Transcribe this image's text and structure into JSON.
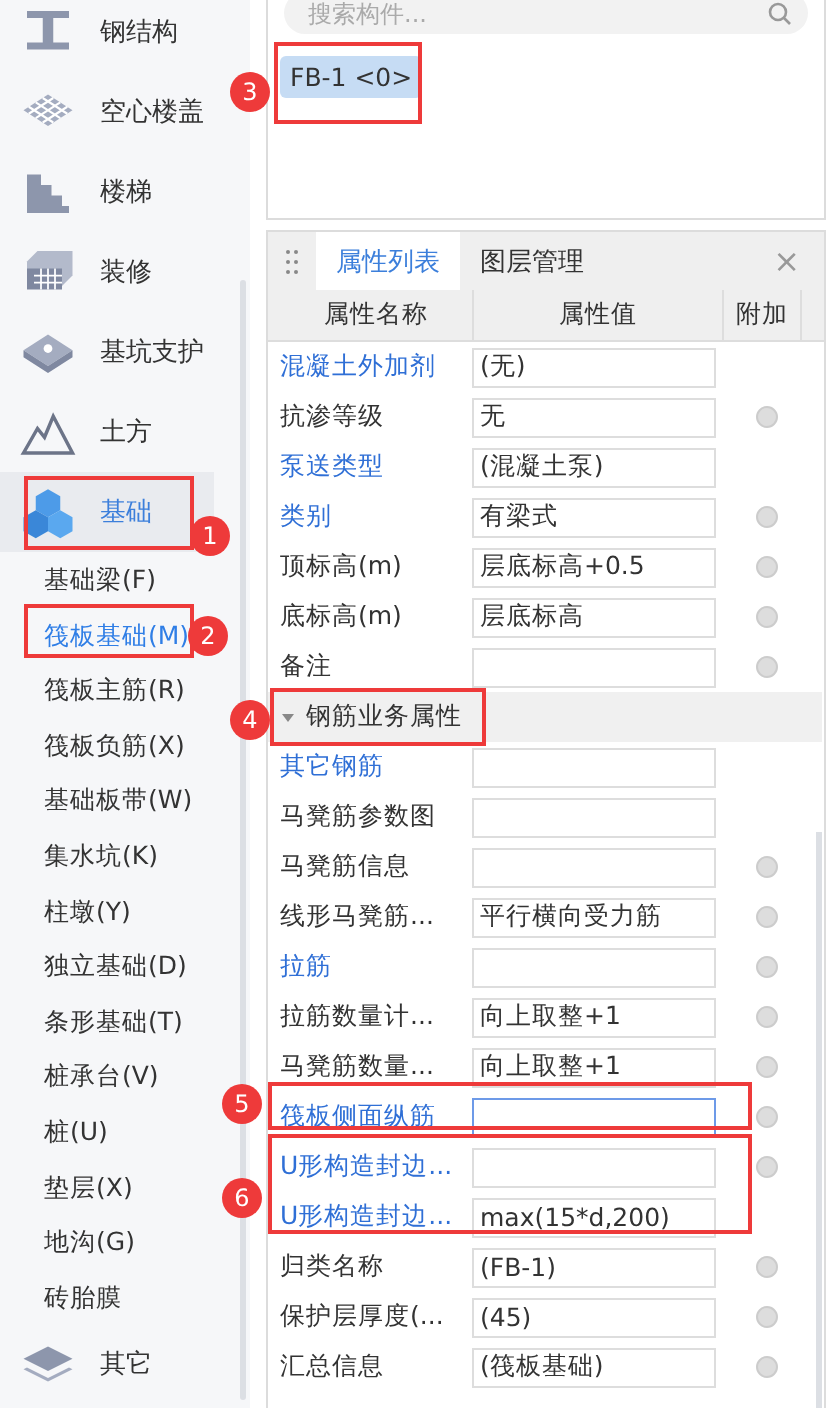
{
  "sidebar": {
    "categories": [
      {
        "label": "钢结构",
        "kind": "beam",
        "selected": false
      },
      {
        "label": "空心楼盖",
        "kind": "grid",
        "selected": false
      },
      {
        "label": "楼梯",
        "kind": "stairs",
        "selected": false
      },
      {
        "label": "装修",
        "kind": "finish",
        "selected": false
      },
      {
        "label": "基坑支护",
        "kind": "pit",
        "selected": false
      },
      {
        "label": "土方",
        "kind": "mountain",
        "selected": false
      },
      {
        "label": "基础",
        "kind": "cubes",
        "selected": true,
        "expanded": true,
        "children": [
          {
            "label": "基础梁(F)",
            "selected": false
          },
          {
            "label": "筏板基础(M)",
            "selected": true
          },
          {
            "label": "筏板主筋(R)",
            "selected": false
          },
          {
            "label": "筏板负筋(X)",
            "selected": false
          },
          {
            "label": "基础板带(W)",
            "selected": false
          },
          {
            "label": "集水坑(K)",
            "selected": false
          },
          {
            "label": "柱墩(Y)",
            "selected": false
          },
          {
            "label": "独立基础(D)",
            "selected": false
          },
          {
            "label": "条形基础(T)",
            "selected": false
          },
          {
            "label": "桩承台(V)",
            "selected": false
          },
          {
            "label": "桩(U)",
            "selected": false
          },
          {
            "label": "垫层(X)",
            "selected": false
          },
          {
            "label": "地沟(G)",
            "selected": false
          },
          {
            "label": "砖胎膜",
            "selected": false
          }
        ]
      },
      {
        "label": "其它",
        "kind": "layers",
        "selected": false
      }
    ]
  },
  "search": {
    "placeholder": "搜索构件..."
  },
  "components": [
    {
      "label": "FB-1 <0>",
      "selected": true
    }
  ],
  "panel": {
    "tabs": [
      {
        "label": "属性列表",
        "selected": true
      },
      {
        "label": "图层管理",
        "selected": false
      }
    ],
    "close": "×",
    "columns": [
      "属性名称",
      "属性值",
      "附加"
    ],
    "rows": [
      {
        "kind": "row",
        "name": "混凝土外加剂",
        "value": "(无)",
        "linked": true,
        "attach": false
      },
      {
        "kind": "row",
        "name": "抗渗等级",
        "value": "无",
        "linked": false,
        "attach": true
      },
      {
        "kind": "row",
        "name": "泵送类型",
        "value": "(混凝土泵)",
        "linked": true,
        "attach": false
      },
      {
        "kind": "row",
        "name": "类别",
        "value": "有梁式",
        "linked": true,
        "attach": true
      },
      {
        "kind": "row",
        "name": "顶标高(m)",
        "value": "层底标高+0.5",
        "linked": false,
        "attach": true
      },
      {
        "kind": "row",
        "name": "底标高(m)",
        "value": "层底标高",
        "linked": false,
        "attach": true
      },
      {
        "kind": "row",
        "name": "备注",
        "value": "",
        "linked": false,
        "attach": true
      },
      {
        "kind": "section",
        "name": "钢筋业务属性",
        "expanded": true
      },
      {
        "kind": "row",
        "name": "其它钢筋",
        "value": "",
        "linked": true,
        "attach": false
      },
      {
        "kind": "row",
        "name": "马凳筋参数图",
        "value": "",
        "linked": false,
        "attach": false
      },
      {
        "kind": "row",
        "name": "马凳筋信息",
        "value": "",
        "linked": false,
        "attach": true
      },
      {
        "kind": "row",
        "name": "线形马凳筋...",
        "value": "平行横向受力筋",
        "linked": false,
        "attach": true
      },
      {
        "kind": "row",
        "name": "拉筋",
        "value": "",
        "linked": true,
        "attach": true
      },
      {
        "kind": "row",
        "name": "拉筋数量计...",
        "value": "向上取整+1",
        "linked": false,
        "attach": true
      },
      {
        "kind": "row",
        "name": "马凳筋数量...",
        "value": "向上取整+1",
        "linked": false,
        "attach": true
      },
      {
        "kind": "row",
        "name": "筏板侧面纵筋",
        "value": "",
        "linked": true,
        "attach": true,
        "focused": true
      },
      {
        "kind": "row",
        "name": "U形构造封边...",
        "value": "",
        "linked": true,
        "attach": true
      },
      {
        "kind": "row",
        "name": "U形构造封边...",
        "value": "max(15*d,200)",
        "linked": true,
        "attach": false
      },
      {
        "kind": "row",
        "name": "归类名称",
        "value": "(FB-1)",
        "linked": false,
        "attach": true
      },
      {
        "kind": "row",
        "name": "保护层厚度(...",
        "value": "(45)",
        "linked": false,
        "attach": true
      },
      {
        "kind": "row",
        "name": "汇总信息",
        "value": "(筏板基础)",
        "linked": false,
        "attach": true
      }
    ]
  },
  "annotations": [
    "1",
    "2",
    "3",
    "4",
    "5",
    "6"
  ]
}
